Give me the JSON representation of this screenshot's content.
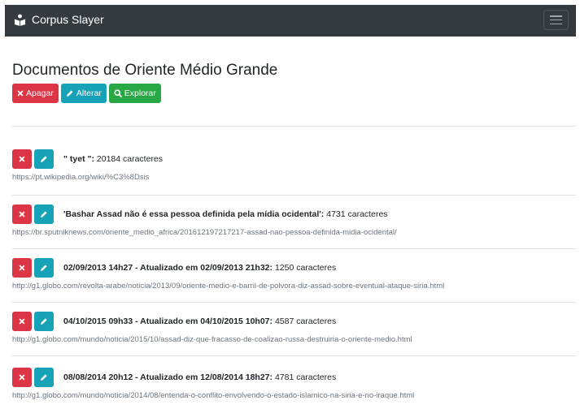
{
  "navbar": {
    "brand": "Corpus Slayer",
    "brand_icon": "book-reader-icon",
    "toggler_icon": "hamburger-menu-icon"
  },
  "page": {
    "title": "Documentos de Oriente Médio Grande"
  },
  "actions": {
    "delete_label": "Apagar",
    "edit_label": "Alterar",
    "explore_label": "Explorar"
  },
  "colors": {
    "navbar_bg": "#343a40",
    "danger": "#dc3545",
    "info": "#17a2b8",
    "success": "#28a745",
    "muted_text": "#6c757d"
  },
  "documents": [
    {
      "title": "\" tyet \":",
      "count": "20184 caracteres",
      "url": "https://pt.wikipedia.org/wiki/%C3%8Dsis"
    },
    {
      "title": "'Bashar Assad não é essa pessoa definida pela mídia ocidental':",
      "count": "4731 caracteres",
      "url": "https://br.sputniknews.com/oriente_medio_africa/201612197217217-assad-nao-pessoa-definida-midia-ocidental/"
    },
    {
      "title": "02/09/2013 14h27 - Atualizado em 02/09/2013 21h32:",
      "count": "1250 caracteres",
      "url": "http://g1.globo.com/revolta-arabe/noticia/2013/09/oriente-medio-e-barril-de-polvora-diz-assad-sobre-eventual-ataque-siria.html"
    },
    {
      "title": "04/10/2015 09h33 - Atualizado em 04/10/2015 10h07:",
      "count": "4587 caracteres",
      "url": "http://g1.globo.com/mundo/noticia/2015/10/assad-diz-que-fracasso-de-coalizao-russa-destruiria-o-oriente-medio.html"
    },
    {
      "title": "08/08/2014 20h12 - Atualizado em 12/08/2014 18h27:",
      "count": "4781 caracteres",
      "url": "http://g1.globo.com/mundo/noticia/2014/08/entenda-o-conflito-envolvendo-o-estado-islamico-na-siria-e-no-iraque.html"
    }
  ]
}
